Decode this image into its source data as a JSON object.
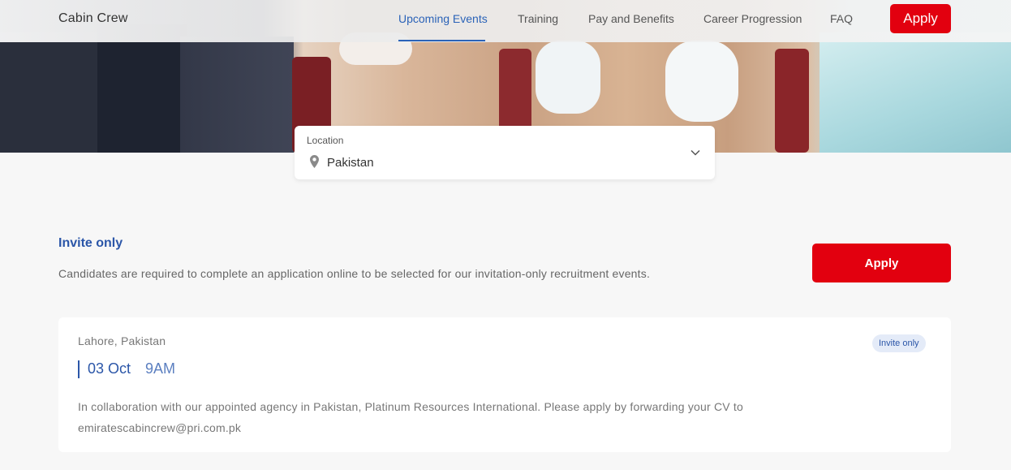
{
  "header": {
    "brand": "Cabin Crew",
    "nav": [
      {
        "label": "Upcoming Events",
        "active": true
      },
      {
        "label": "Training",
        "active": false
      },
      {
        "label": "Pay and Benefits",
        "active": false
      },
      {
        "label": "Career Progression",
        "active": false
      },
      {
        "label": "FAQ",
        "active": false
      }
    ],
    "apply_label": "Apply"
  },
  "location": {
    "label": "Location",
    "value": "Pakistan",
    "icon": "map-pin-icon"
  },
  "invite": {
    "title": "Invite only",
    "description": "Candidates are required to complete an application online to be selected for our invitation-only recruitment events.",
    "apply_label": "Apply"
  },
  "event": {
    "city": "Lahore, Pakistan",
    "badge": "Invite only",
    "date": "03 Oct",
    "time": "9AM",
    "description_line1": "In collaboration with our appointed agency in Pakistan, Platinum Resources International. Please apply by forwarding your CV to",
    "description_line2": "emiratescabincrew@pri.com.pk"
  },
  "colors": {
    "accent_blue": "#2b56a8",
    "apply_red": "#e2000f"
  }
}
